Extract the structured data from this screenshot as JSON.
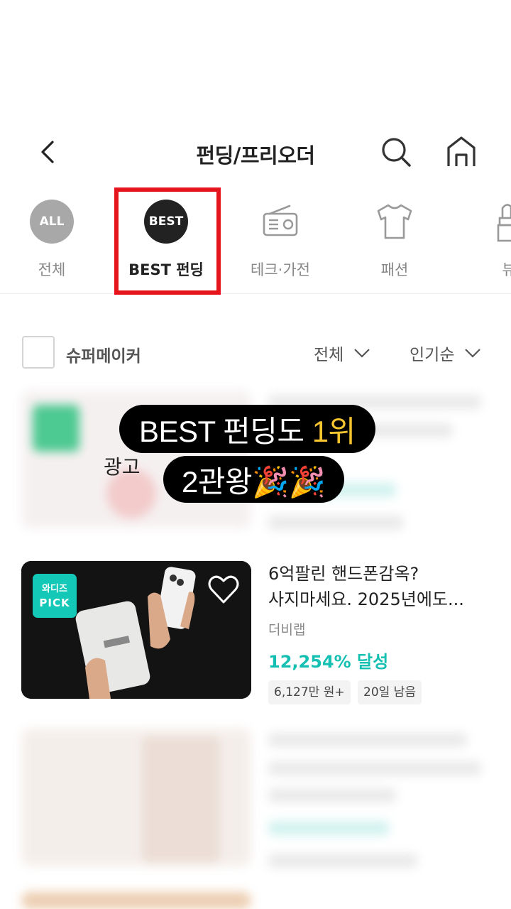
{
  "header": {
    "title": "펀딩/프리오더"
  },
  "categories": [
    {
      "icon_text": "ALL",
      "label": "전체"
    },
    {
      "icon_text": "BEST",
      "label": "BEST 펀딩"
    },
    {
      "icon": "radio-icon",
      "label": "테크·가전"
    },
    {
      "icon": "tshirt-icon",
      "label": "패션"
    },
    {
      "icon": "lipstick-icon",
      "label": "뷰"
    }
  ],
  "filter": {
    "checkbox_label": "슈퍼메이커",
    "dropdown_scope": "전체",
    "dropdown_sort": "인기순"
  },
  "overlay": {
    "line1_white": "BEST 펀딩도 ",
    "line1_yellow": "1위",
    "line2": "2관왕🎉🎉"
  },
  "ad_label": "광고",
  "product": {
    "badge_line1": "와디즈",
    "badge_line2": "PICK",
    "title_line1": "6억팔린 핸드폰감옥?",
    "title_line2": "사지마세요. 2025년에도...",
    "maker": "더비랩",
    "rate": "12,254% 달성",
    "chip_amount": "6,127만 원+",
    "chip_days": "20일 남음"
  },
  "colors": {
    "accent_teal": "#15c0b2",
    "highlight_red": "#e5141d",
    "overlay_yellow": "#f6c42e"
  }
}
